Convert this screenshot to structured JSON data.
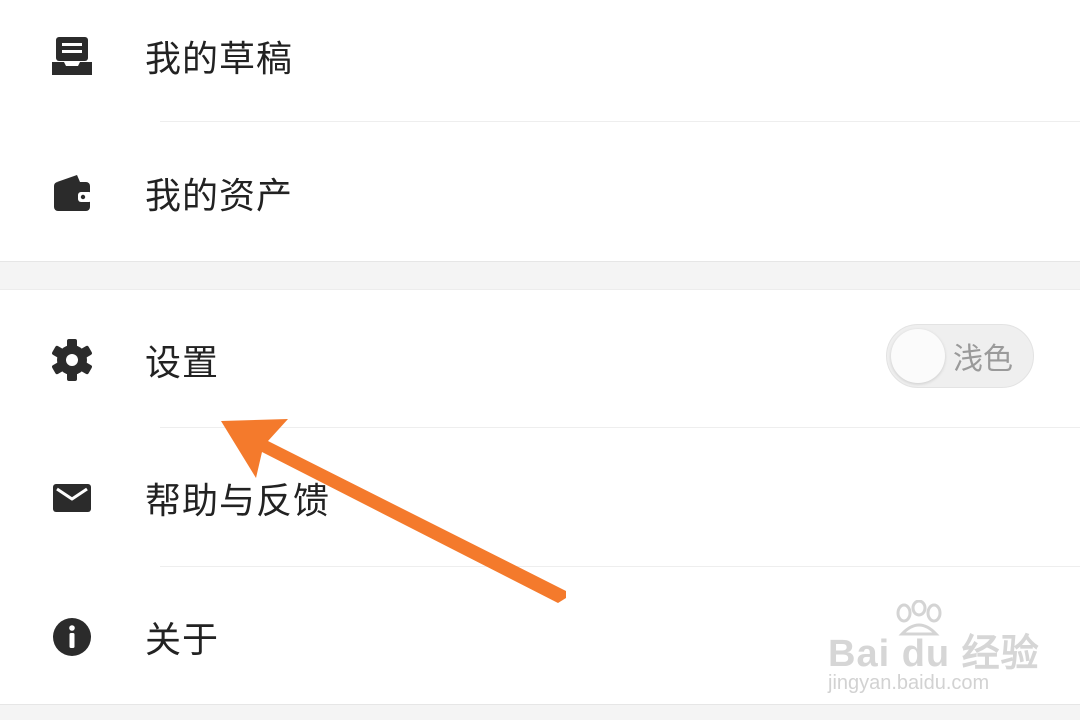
{
  "menu_group_1": {
    "items": [
      {
        "icon": "drafts-tray-icon",
        "label": "我的草稿"
      },
      {
        "icon": "wallet-icon",
        "label": "我的资产"
      }
    ]
  },
  "menu_group_2": {
    "items": [
      {
        "icon": "gear-icon",
        "label": "设置",
        "toggle_label": "浅色"
      },
      {
        "icon": "mail-icon",
        "label": "帮助与反馈"
      },
      {
        "icon": "info-icon",
        "label": "关于"
      }
    ]
  },
  "annotation": {
    "arrow_color": "#f47a2c"
  },
  "watermark": {
    "brand": "Bai du 经验",
    "url": "jingyan.baidu.com"
  },
  "colors": {
    "text": "#222222",
    "icon": "#2b2b2b",
    "background": "#ffffff",
    "section_gap": "#f4f4f4"
  }
}
